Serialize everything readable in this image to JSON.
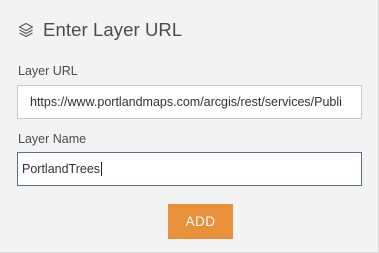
{
  "panel": {
    "title": "Enter Layer URL",
    "title_icon": "layers-icon"
  },
  "layer_url": {
    "label": "Layer URL",
    "value": "https://www.portlandmaps.com/arcgis/rest/services/Publi"
  },
  "layer_name": {
    "label": "Layer Name",
    "value": "PortlandTrees"
  },
  "add_button": {
    "label": "ADD",
    "color": "#e8913a"
  }
}
